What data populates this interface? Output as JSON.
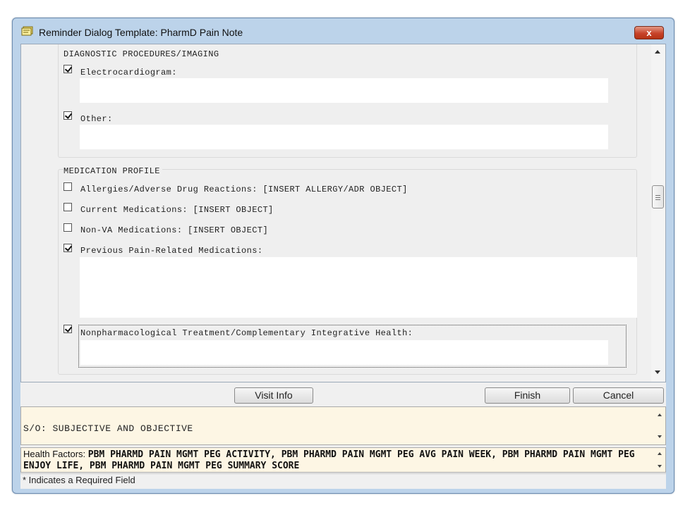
{
  "window": {
    "title": "Reminder Dialog Template: PharmD Pain Note",
    "close_label": "x"
  },
  "groups": {
    "diagnostic": {
      "title": "DIAGNOSTIC PROCEDURES/IMAGING",
      "items": [
        {
          "label": "Electrocardiogram:",
          "checked": true
        },
        {
          "label": "Other:",
          "checked": true
        }
      ]
    },
    "medication": {
      "title": "MEDICATION PROFILE",
      "items": [
        {
          "label": "Allergies/Adverse Drug Reactions: [INSERT ALLERGY/ADR OBJECT]",
          "checked": false
        },
        {
          "label": "Current Medications: [INSERT OBJECT]",
          "checked": false
        },
        {
          "label": "Non-VA Medications: [INSERT OBJECT]",
          "checked": false
        },
        {
          "label": "Previous Pain-Related Medications:",
          "checked": true
        },
        {
          "label": "Nonpharmacological Treatment/Complementary Integrative Health:",
          "checked": true
        }
      ]
    }
  },
  "buttons": {
    "visit_info": "Visit Info",
    "finish": "Finish",
    "cancel": "Cancel"
  },
  "section_text": "S/O: SUBJECTIVE AND OBJECTIVE",
  "health_factors": {
    "label": "Health Factors: ",
    "value": "PBM PHARMD PAIN MGMT PEG ACTIVITY, PBM PHARMD PAIN MGMT PEG AVG PAIN WEEK, PBM PHARMD PAIN MGMT PEG ENJOY LIFE, PBM PHARMD PAIN MGMT PEG SUMMARY SCORE"
  },
  "status_text": "* Indicates a Required Field"
}
